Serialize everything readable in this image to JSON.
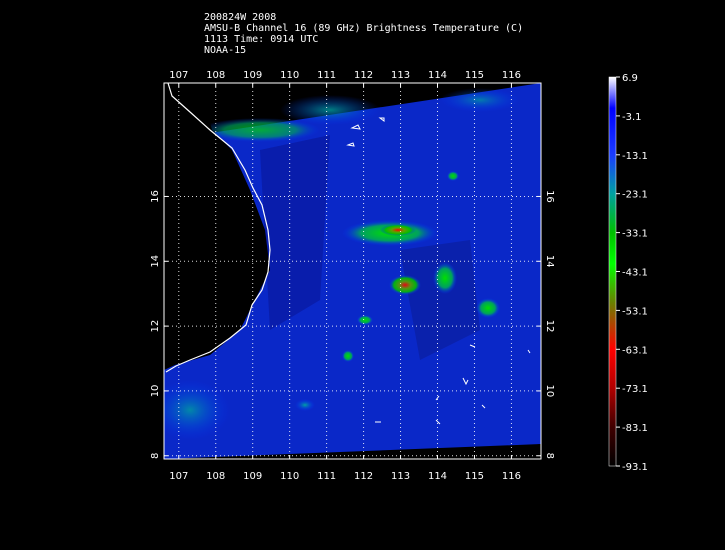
{
  "header": {
    "line1": "200824W 2008",
    "line2": "AMSU-B Channel 16 (89 GHz) Brightness Temperature (C)",
    "line3": "1113 Time: 0914 UTC",
    "line4": "NOAA-15"
  },
  "map": {
    "lon_ticks": [
      "107",
      "108",
      "109",
      "110",
      "111",
      "112",
      "113",
      "114",
      "115",
      "116"
    ],
    "lat_ticks": [
      "8",
      "10",
      "12",
      "14",
      "16"
    ],
    "lon_range": [
      106.6,
      116.8
    ],
    "lat_range": [
      7.9,
      19.5
    ]
  },
  "colorbar": {
    "labels": [
      "6.9",
      "-3.1",
      "-13.1",
      "-23.1",
      "-33.1",
      "-43.1",
      "-53.1",
      "-63.1",
      "-73.1",
      "-83.1",
      "-93.1"
    ],
    "colors": [
      "#ffffff",
      "#0000ff",
      "#1a3cff",
      "#00a0a0",
      "#00c000",
      "#00ff00",
      "#808000",
      "#ff0000",
      "#a00000",
      "#400000",
      "#000000"
    ]
  }
}
